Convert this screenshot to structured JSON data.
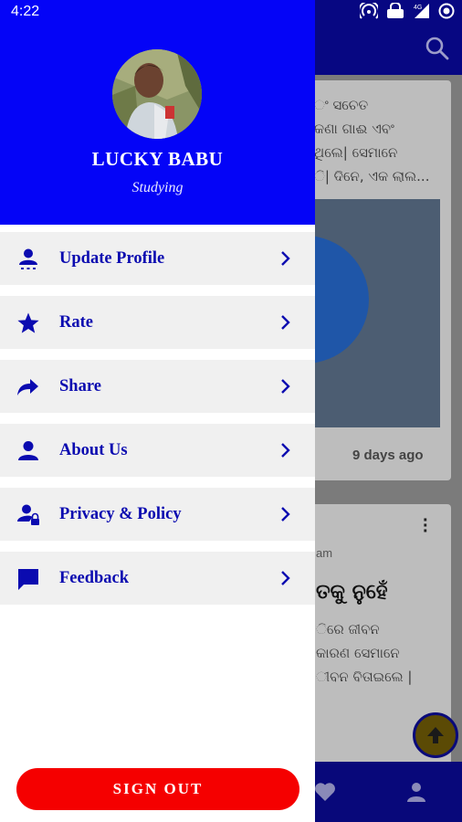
{
  "status_bar": {
    "time": "4:22",
    "icons": [
      "hotspot-icon",
      "vpn-icon",
      "signal-4g-icon",
      "battery-icon"
    ]
  },
  "drawer": {
    "profile": {
      "name": "LUCKY BABU",
      "subtitle": "Studying"
    },
    "menu": [
      {
        "label": "Update Profile",
        "icon": "person-list-icon"
      },
      {
        "label": "Rate",
        "icon": "star-icon"
      },
      {
        "label": "Share",
        "icon": "share-arrow-icon"
      },
      {
        "label": "About Us",
        "icon": "person-icon"
      },
      {
        "label": "Privacy & Policy",
        "icon": "person-lock-icon"
      },
      {
        "label": "Feedback",
        "icon": "feedback-icon"
      }
    ],
    "sign_out_label": "SIGN OUT"
  },
  "background": {
    "card1_lines": [
      "ଂ ସଚେତ",
      "କଣା ଗାଈ ଏବଂ",
      "ଥିଲେ| ସେମାନେ",
      "ି| ଦିନେ, ଏକ ଲାଲ..."
    ],
    "card1_date": "9 days ago",
    "card2_small": "am",
    "card2_heading": "ତକୁ ନୁହେଁ",
    "card2_lines": [
      "ିରେ ଜୀବନ",
      "କାରଣ ସେମାନେ",
      "ୀବନ ବିତାଇଲେ |"
    ]
  },
  "colors": {
    "drawer_header": "#0404f7",
    "menu_text": "#0b0bb0",
    "menu_bg": "#f0f0f0",
    "sign_out_bg": "#f50000"
  }
}
